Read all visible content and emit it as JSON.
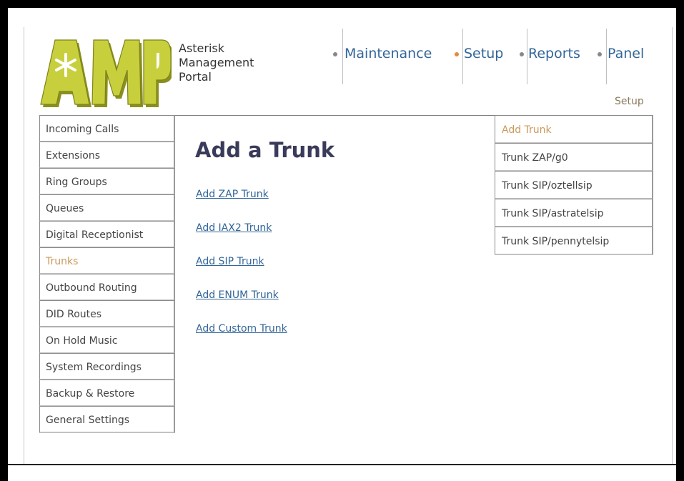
{
  "header": {
    "logo_text": "AMP",
    "portal_title": "Asterisk\nManagement\nPortal",
    "section_label": "Setup"
  },
  "nav": {
    "items": [
      {
        "label": "Maintenance",
        "bullet_color": "#888888"
      },
      {
        "label": "Setup",
        "bullet_color": "#e38a3a"
      },
      {
        "label": "Reports",
        "bullet_color": "#888888"
      },
      {
        "label": "Panel",
        "bullet_color": "#888888"
      }
    ]
  },
  "sidebar": {
    "items": [
      {
        "label": "Incoming Calls"
      },
      {
        "label": "Extensions"
      },
      {
        "label": "Ring Groups"
      },
      {
        "label": "Queues"
      },
      {
        "label": "Digital Receptionist"
      },
      {
        "label": "Trunks",
        "active": true
      },
      {
        "label": "Outbound Routing"
      },
      {
        "label": "DID Routes"
      },
      {
        "label": "On Hold Music"
      },
      {
        "label": "System Recordings"
      },
      {
        "label": "Backup & Restore"
      },
      {
        "label": "General Settings"
      }
    ]
  },
  "main": {
    "heading": "Add a Trunk",
    "links": [
      {
        "label": "Add ZAP Trunk"
      },
      {
        "label": "Add IAX2 Trunk"
      },
      {
        "label": "Add SIP Trunk"
      },
      {
        "label": "Add ENUM Trunk"
      },
      {
        "label": "Add Custom Trunk"
      }
    ]
  },
  "trunk_list": {
    "items": [
      {
        "label": "Add Trunk",
        "active": true
      },
      {
        "label": "Trunk ZAP/g0"
      },
      {
        "label": "Trunk SIP/oztellsip"
      },
      {
        "label": "Trunk SIP/astratelsip"
      },
      {
        "label": "Trunk SIP/pennytelsip"
      }
    ]
  },
  "colors": {
    "link": "#336699",
    "active_menu": "#c99a5c",
    "logo_fill": "#c8cf3c",
    "logo_shadow": "#8a8f20"
  }
}
